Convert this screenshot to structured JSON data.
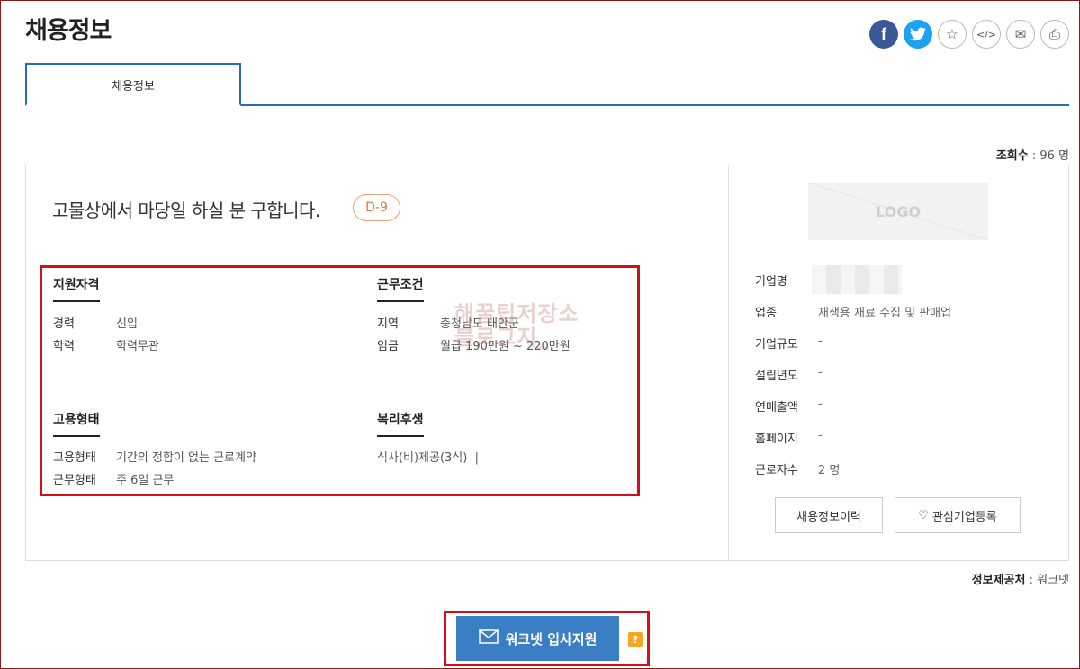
{
  "header": {
    "title": "채용정보",
    "share": [
      {
        "icon": "facebook-icon",
        "glyph": "f"
      },
      {
        "icon": "twitter-icon",
        "glyph": "🐦"
      },
      {
        "icon": "star-icon",
        "glyph": "☆"
      },
      {
        "icon": "embed-code-icon",
        "glyph": "</>"
      },
      {
        "icon": "mail-icon",
        "glyph": "✉"
      },
      {
        "icon": "print-icon",
        "glyph": "⎙"
      }
    ]
  },
  "tabs": [
    {
      "label": "채용정보"
    }
  ],
  "views": {
    "label": "조회수",
    "value": " : 96 명"
  },
  "job": {
    "title": "고물상에서 마당일 하실 분 구합니다.",
    "dday": "D-9"
  },
  "sections": {
    "qualification": {
      "heading": "지원자격",
      "rows": [
        {
          "key": "경력",
          "value": "신입"
        },
        {
          "key": "학력",
          "value": "학력무관"
        }
      ]
    },
    "conditions": {
      "heading": "근무조건",
      "rows": [
        {
          "key": "지역",
          "value": "충청남도 태안군"
        },
        {
          "key": "임금",
          "value": "월급 190만원 ~ 220만원"
        }
      ]
    },
    "employment": {
      "heading": "고용형태",
      "rows": [
        {
          "key": "고용형태",
          "value": "기간의 정함이 없는 근로계약"
        },
        {
          "key": "근무형태",
          "value": "주 6일 근무"
        }
      ]
    },
    "welfare": {
      "heading": "복리후생",
      "value": "식사(비)제공(3식)  |"
    }
  },
  "watermark": {
    "line1": "해꿀팁저장소",
    "line2": "블로그지_"
  },
  "company": {
    "logo_text": "LOGO",
    "rows": [
      {
        "key": "기업명",
        "value": ""
      },
      {
        "key": "업종",
        "value": "재생용 재료 수집 및 판매업"
      },
      {
        "key": "기업규모",
        "value": "-"
      },
      {
        "key": "설립년도",
        "value": "-"
      },
      {
        "key": "연매출액",
        "value": "-"
      },
      {
        "key": "홈페이지",
        "value": "-"
      },
      {
        "key": "근로자수",
        "value": "2 명"
      }
    ],
    "history_button": "채용정보이력",
    "favorite_button": "관심기업등록"
  },
  "provider": {
    "label": "정보제공처",
    "value": " : 워크넷"
  },
  "apply": {
    "label": "워크넷 입사지원",
    "help": "?"
  },
  "colors": {
    "accent": "#2a6cb0",
    "apply": "#3a7fc4",
    "highlight": "#d0101b",
    "dday": "#e07a3a"
  }
}
